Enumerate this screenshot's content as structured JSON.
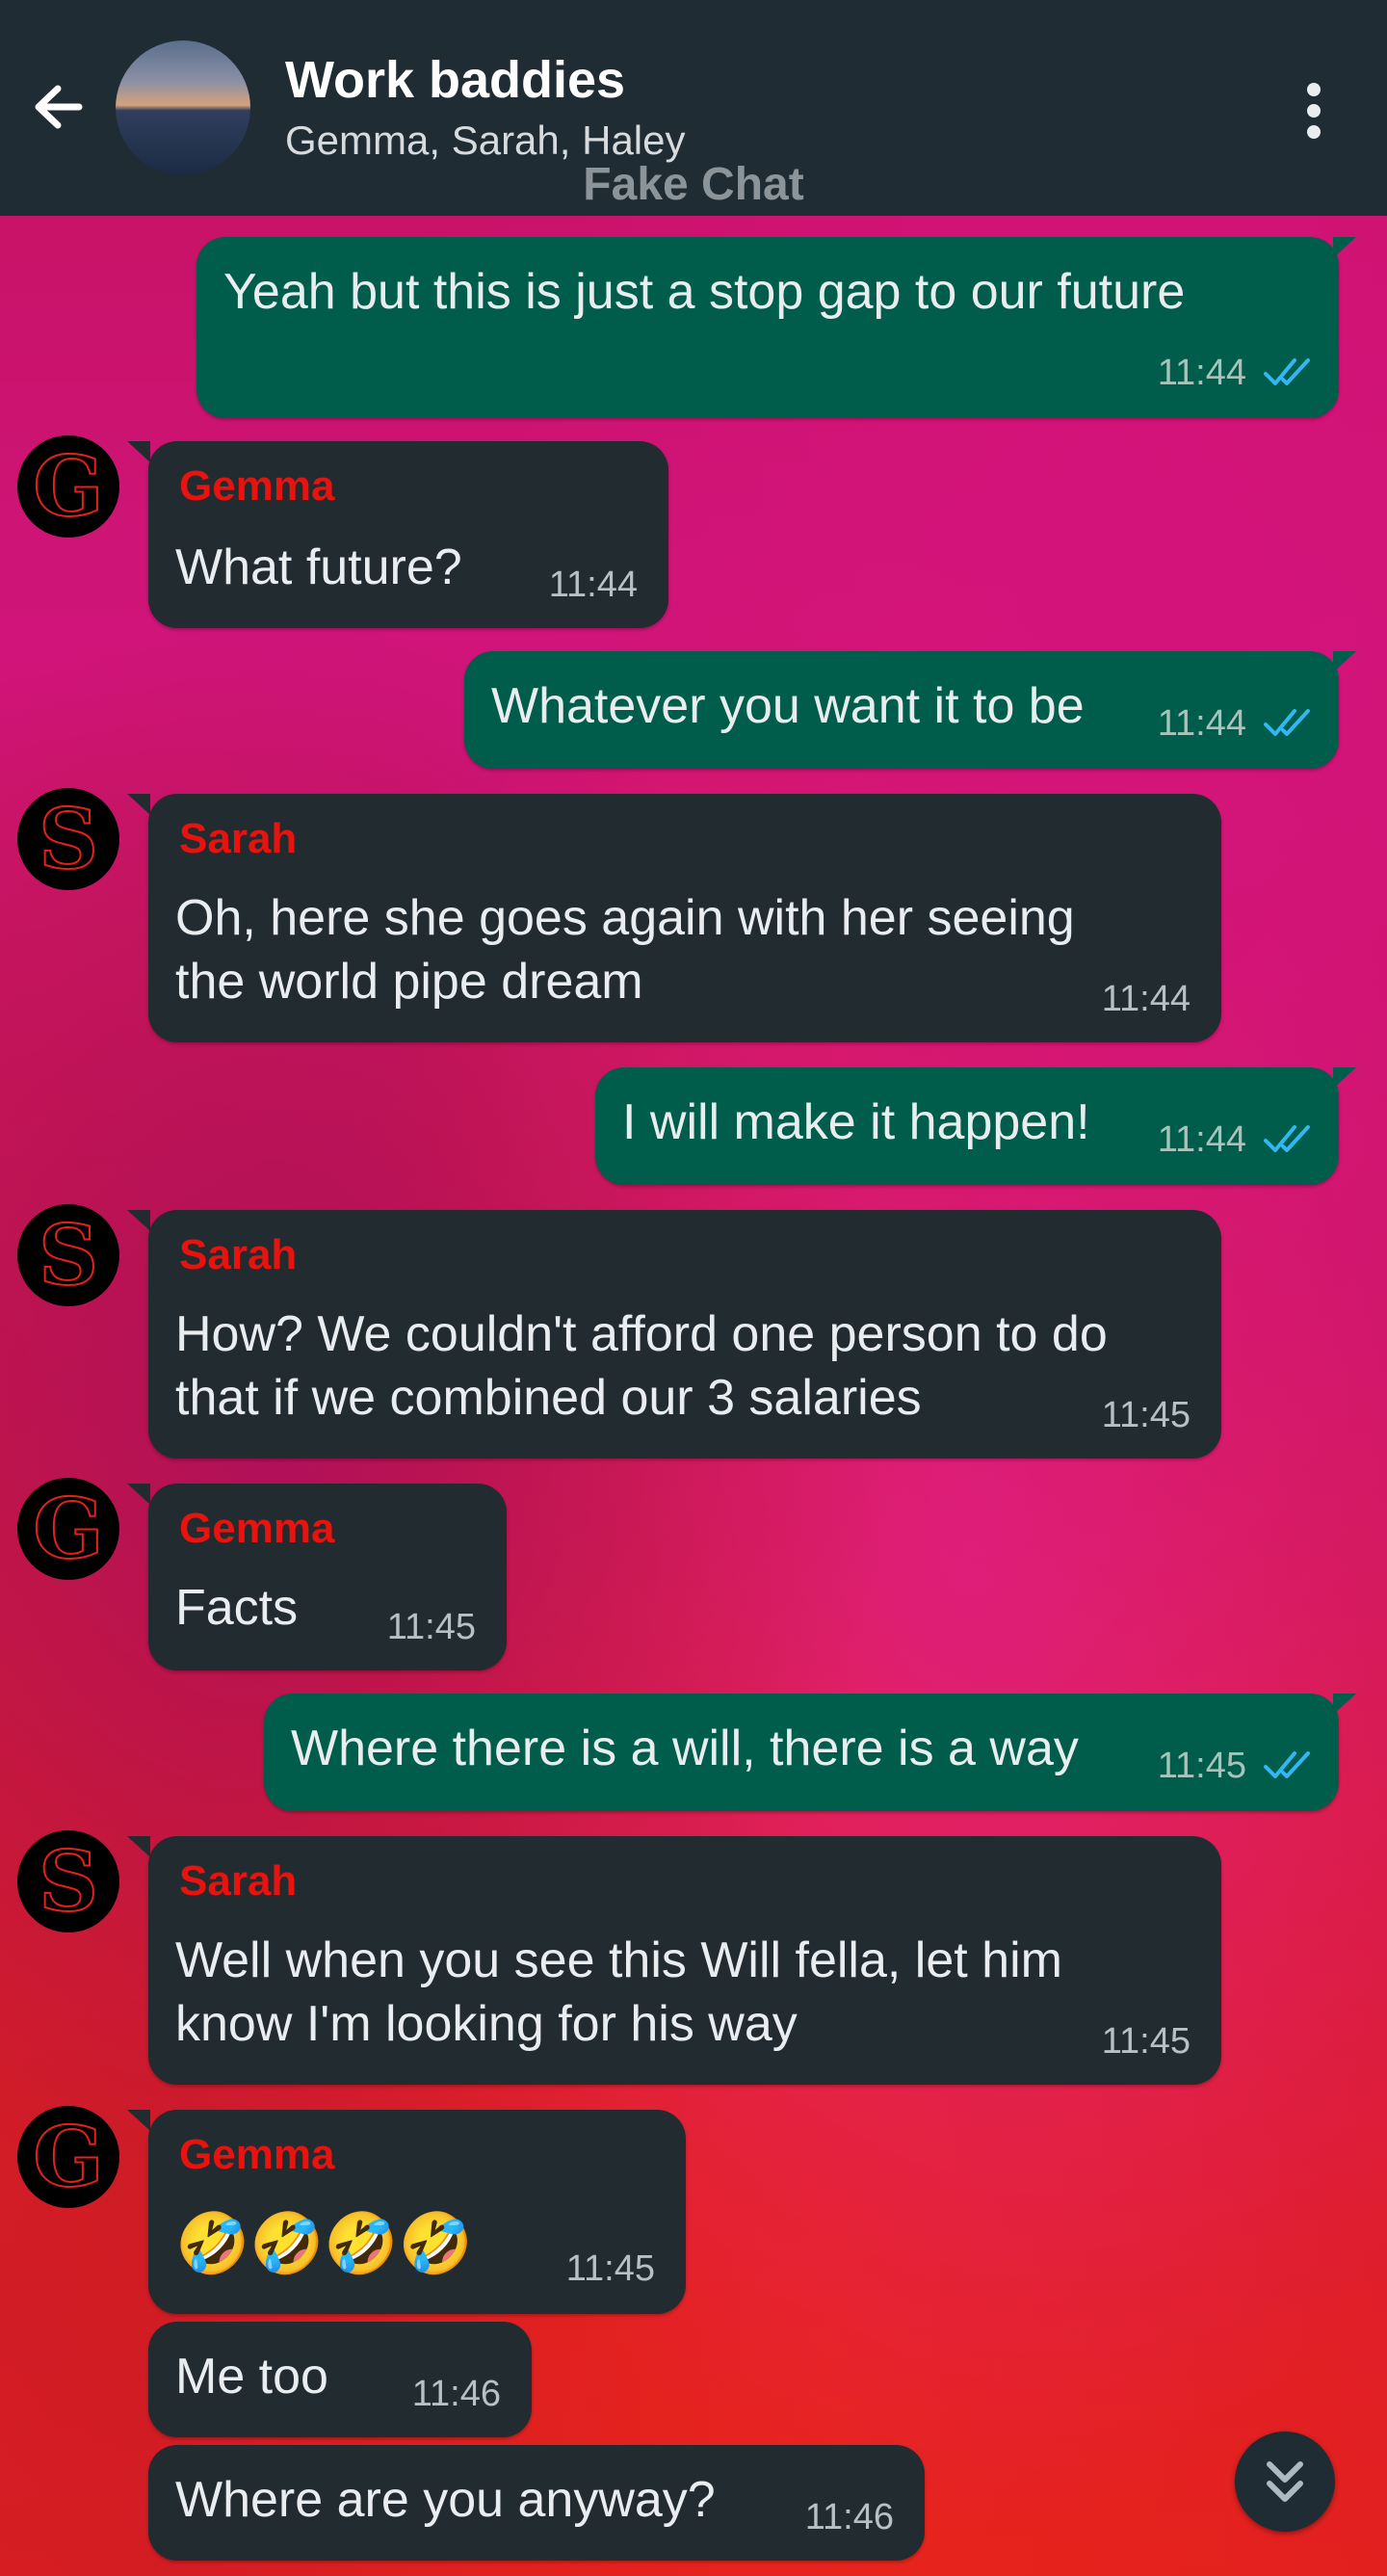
{
  "header": {
    "title": "Work baddies",
    "subtitle": "Gemma, Sarah, Haley",
    "watermark": "Fake Chat"
  },
  "colors": {
    "header_bg": "#202c33",
    "outgoing_bubble": "#005c4b",
    "incoming_bubble": "#222b30",
    "sender_name": "#e8120e",
    "read_ticks": "#34b7f1"
  },
  "icons": {
    "back": "arrow-left-icon",
    "menu": "more-vertical-icon",
    "read_receipt": "double-check-icon",
    "scroll_down": "double-chevron-down-icon"
  },
  "messages": [
    {
      "direction": "out",
      "text": "Yeah but this is just a stop gap to our future",
      "time": "11:44",
      "status": "read"
    },
    {
      "direction": "in",
      "sender": "Gemma",
      "avatar": "G",
      "lines": [
        "What future?"
      ],
      "time": "11:44"
    },
    {
      "direction": "out",
      "text": "Whatever you want it to be",
      "time": "11:44",
      "status": "read"
    },
    {
      "direction": "in",
      "sender": "Sarah",
      "avatar": "S",
      "lines": [
        "Oh, here she goes again with her seeing",
        "the world pipe dream"
      ],
      "time": "11:44"
    },
    {
      "direction": "out",
      "text": "I will make it happen!",
      "time": "11:44",
      "status": "read"
    },
    {
      "direction": "in",
      "sender": "Sarah",
      "avatar": "S",
      "lines": [
        "How? We couldn't afford one person to do",
        "that if we combined our 3 salaries"
      ],
      "time": "11:45"
    },
    {
      "direction": "in",
      "sender": "Gemma",
      "avatar": "G",
      "lines": [
        "Facts"
      ],
      "time": "11:45"
    },
    {
      "direction": "out",
      "text": "Where there is a will, there is a way",
      "time": "11:45",
      "status": "read"
    },
    {
      "direction": "in",
      "sender": "Sarah",
      "avatar": "S",
      "lines": [
        "Well when you see this Will fella, let him",
        "know I'm looking for his way"
      ],
      "time": "11:45"
    },
    {
      "direction": "in",
      "sender": "Gemma",
      "avatar": "G",
      "lines": [
        "🤣🤣🤣🤣"
      ],
      "time": "11:45"
    },
    {
      "direction": "in",
      "lines": [
        "Me too"
      ],
      "time": "11:46"
    },
    {
      "direction": "in",
      "lines": [
        "Where are you anyway?"
      ],
      "time": "11:46"
    }
  ]
}
